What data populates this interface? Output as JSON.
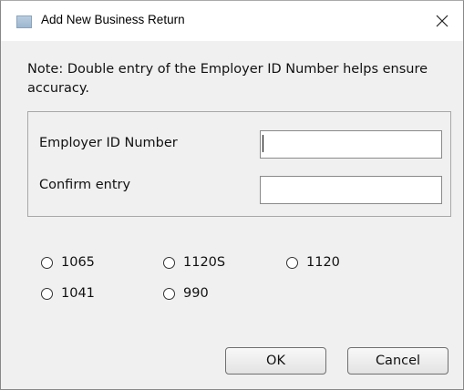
{
  "window": {
    "title": "Add New Business Return",
    "close_glyph": "✕"
  },
  "note": "Note: Double entry of the Employer ID Number helps ensure accuracy.",
  "fields": {
    "ein_label": "Employer ID Number",
    "ein_value": "",
    "confirm_label": "Confirm entry",
    "confirm_value": ""
  },
  "return_types": [
    "1065",
    "1120S",
    "1120",
    "1041",
    "990"
  ],
  "selected_return_type": null,
  "buttons": {
    "ok": "OK",
    "cancel": "Cancel"
  },
  "colors": {
    "dialog_bg": "#f0f0f0",
    "titlebar_bg": "#ffffff",
    "text": "#111111"
  }
}
